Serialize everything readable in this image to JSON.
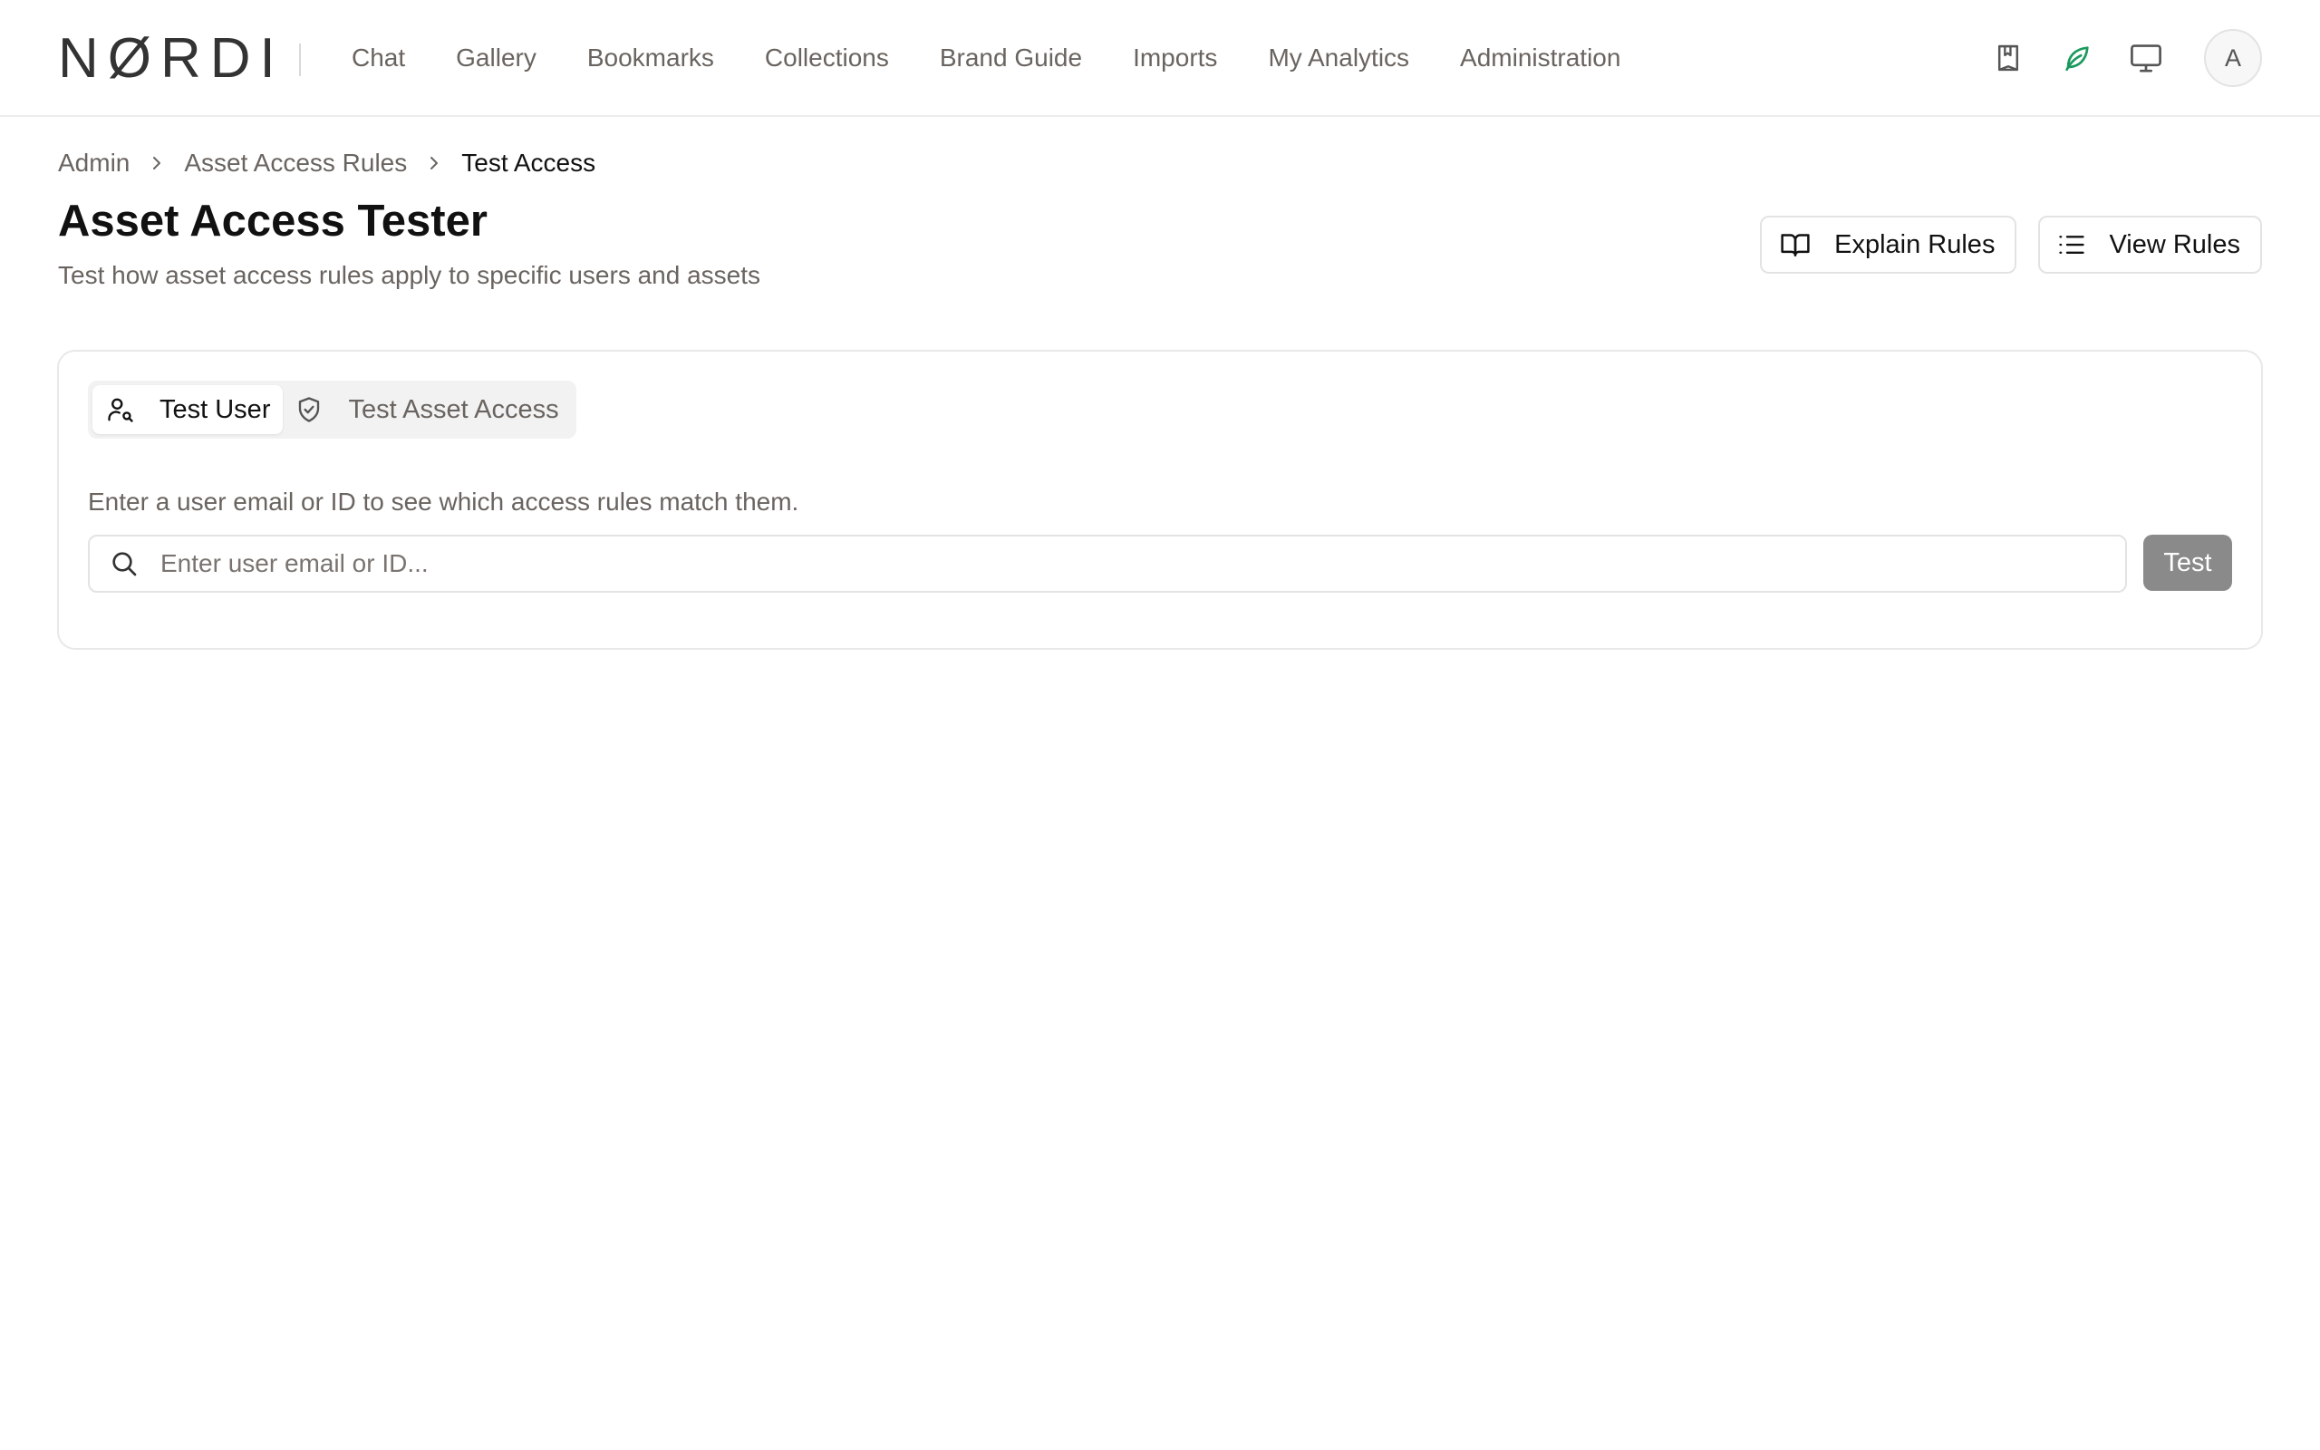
{
  "app": {
    "logo": "NØRDI"
  },
  "nav": {
    "items": [
      {
        "label": "Chat"
      },
      {
        "label": "Gallery"
      },
      {
        "label": "Bookmarks"
      },
      {
        "label": "Collections"
      },
      {
        "label": "Brand Guide"
      },
      {
        "label": "Imports"
      },
      {
        "label": "My Analytics"
      },
      {
        "label": "Administration"
      }
    ]
  },
  "header_icons": {
    "bookmark": "bookmark-icon",
    "leaf": "leaf-icon",
    "monitor": "monitor-icon",
    "avatar_initial": "A",
    "leaf_color": "#1a9a5c"
  },
  "breadcrumb": {
    "items": [
      {
        "label": "Admin"
      },
      {
        "label": "Asset Access Rules"
      },
      {
        "label": "Test Access"
      }
    ]
  },
  "page": {
    "title": "Asset Access Tester",
    "subtitle": "Test how asset access rules apply to specific users and assets"
  },
  "actions": {
    "explain_label": "Explain Rules",
    "view_label": "View Rules"
  },
  "tester": {
    "tabs": [
      {
        "label": "Test User",
        "icon": "user-search-icon",
        "active": true
      },
      {
        "label": "Test Asset Access",
        "icon": "shield-check-icon",
        "active": false
      }
    ],
    "hint": "Enter a user email or ID to see which access rules match them.",
    "search_value": "",
    "search_placeholder": "Enter user email or ID...",
    "test_label": "Test"
  }
}
